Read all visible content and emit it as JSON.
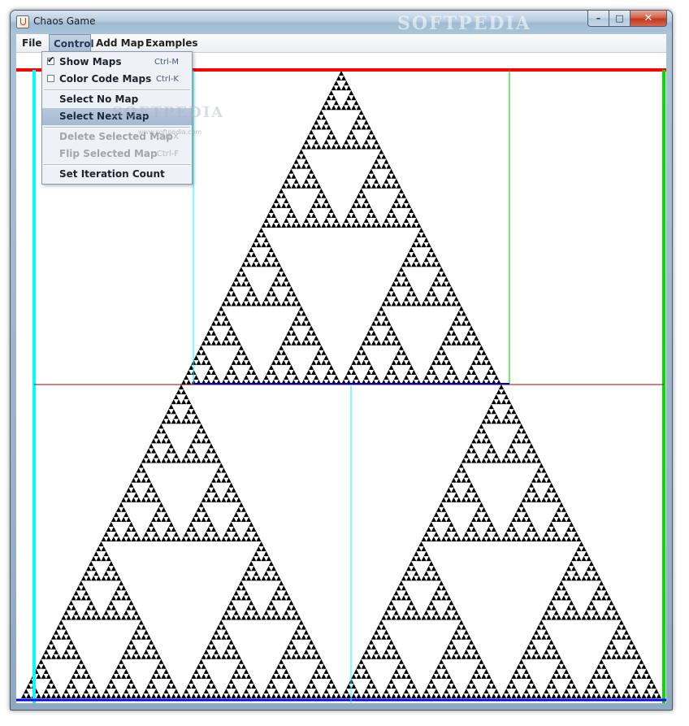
{
  "window": {
    "title": "Chaos Game",
    "watermark": "SOFTPEDIA"
  },
  "caption": {
    "minimize": "–",
    "maximize": "□",
    "close": "✕"
  },
  "menubar": [
    {
      "label": "File"
    },
    {
      "label": "Control"
    },
    {
      "label": "Add Map"
    },
    {
      "label": "Examples"
    }
  ],
  "control_menu": {
    "show_maps": {
      "label": "Show Maps",
      "accel": "Ctrl-M",
      "checked": true
    },
    "color_code_maps": {
      "label": "Color Code Maps",
      "accel": "Ctrl-K",
      "checked": false
    },
    "select_no_map": {
      "label": "Select No Map"
    },
    "select_next_map": {
      "label": "Select Next Map"
    },
    "delete_selected_map": {
      "label": "Delete Selected Map",
      "accel": "Ctrl-X"
    },
    "flip_selected_map": {
      "label": "Flip Selected Map",
      "accel": "Ctrl-F"
    },
    "set_iteration_count": {
      "label": "Set Iteration Count"
    }
  },
  "overlay_watermark": {
    "text": "SOFTPEDIA",
    "sub": "www.softpedia.com"
  },
  "canvas": {
    "fractal": "sierpinski-triangle",
    "depth": 7,
    "colors": {
      "fill": "#000000",
      "top_border": "#ff0000",
      "right_border": "#00e000",
      "left_border": "#00ffff",
      "bottom_border": "#0000ff",
      "map_red": "#990000",
      "map_green": "#00cc00",
      "map_cyan": "#00ffff",
      "map_blue": "#0000cc"
    }
  }
}
